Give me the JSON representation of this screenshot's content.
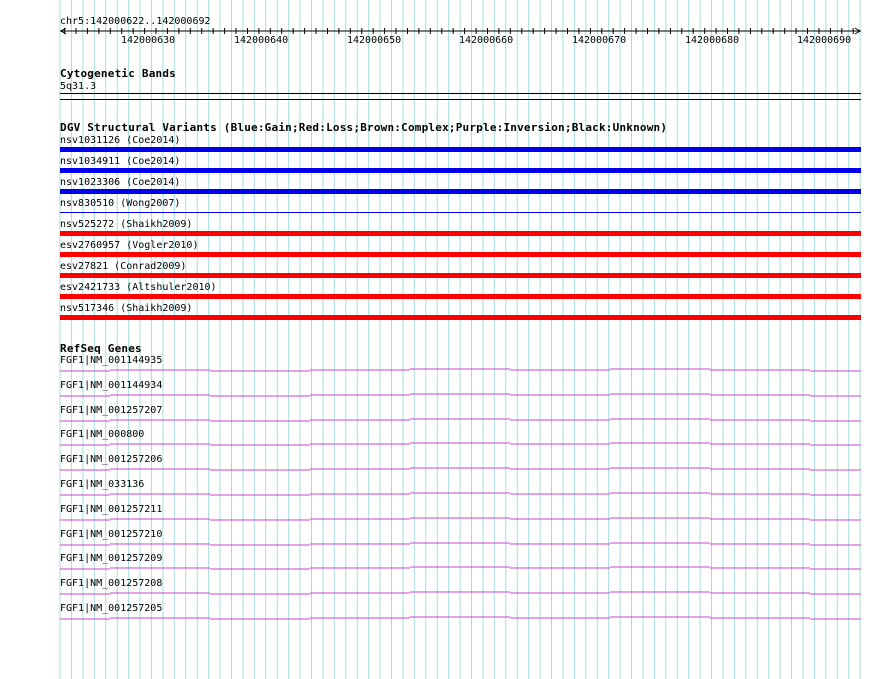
{
  "ruler": {
    "location": "chr5:142000622..142000692",
    "ticks": [
      "142000630",
      "142000640",
      "142000650",
      "142000660",
      "142000670",
      "142000680",
      "142000690"
    ]
  },
  "cytoband": {
    "title": "Cytogenetic Bands",
    "band": "5q31.3"
  },
  "dgv": {
    "title": "DGV Structural Variants (Blue:Gain;Red:Loss;Brown:Complex;Purple:Inversion;Black:Unknown)",
    "colors": {
      "gain": "#0000ee",
      "loss": "#ff0000"
    },
    "items": [
      {
        "label": "nsv1031126 (Coe2014)",
        "type": "gain",
        "style": "thick"
      },
      {
        "label": "nsv1034911 (Coe2014)",
        "type": "gain",
        "style": "thick"
      },
      {
        "label": "nsv1023306 (Coe2014)",
        "type": "gain",
        "style": "thick"
      },
      {
        "label": "nsv830510 (Wong2007)",
        "type": "gain",
        "style": "thin"
      },
      {
        "label": "nsv525272 (Shaikh2009)",
        "type": "loss",
        "style": "thick"
      },
      {
        "label": "esv2760957 (Vogler2010)",
        "type": "loss",
        "style": "thick"
      },
      {
        "label": "esv27821 (Conrad2009)",
        "type": "loss",
        "style": "thick"
      },
      {
        "label": "esv2421733 (Altshuler2010)",
        "type": "loss",
        "style": "thick"
      },
      {
        "label": "nsv517346 (Shaikh2009)",
        "type": "loss",
        "style": "thick"
      }
    ]
  },
  "refseq": {
    "title": "RefSeq Genes",
    "color": "#cc44cc",
    "genes": [
      "FGF1|NM_001144935",
      "FGF1|NM_001144934",
      "FGF1|NM_001257207",
      "FGF1|NM_000800",
      "FGF1|NM_001257206",
      "FGF1|NM_033136",
      "FGF1|NM_001257211",
      "FGF1|NM_001257210",
      "FGF1|NM_001257209",
      "FGF1|NM_001257208",
      "FGF1|NM_001257205"
    ]
  }
}
